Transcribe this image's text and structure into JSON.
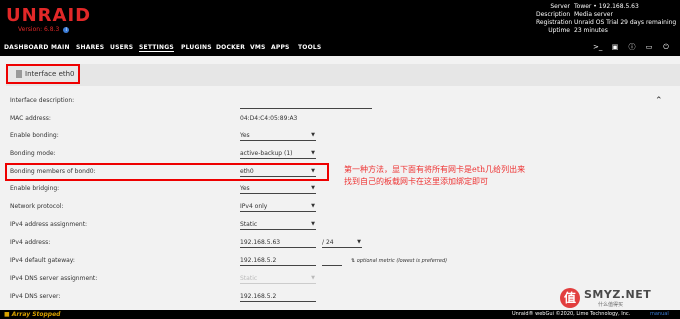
{
  "header": {
    "logo": "UNRAID",
    "version": "Version: 6.8.3",
    "server_info": [
      {
        "key": "Server",
        "value": "Tower • 192.168.5.63"
      },
      {
        "key": "Description",
        "value": "Media server"
      },
      {
        "key": "Registration",
        "value": "Unraid OS Trial 29 days remaining"
      },
      {
        "key": "Uptime",
        "value": "23 minutes"
      }
    ]
  },
  "nav": {
    "items": [
      "DASHBOARD",
      "MAIN",
      "SHARES",
      "USERS",
      "SETTINGS",
      "PLUGINS",
      "DOCKER",
      "VMS",
      "APPS",
      "TOOLS"
    ],
    "active": "SETTINGS",
    "icons": [
      "terminal-icon",
      "feedback-icon",
      "info-icon",
      "monitor-icon",
      "power-icon"
    ]
  },
  "panel": {
    "title": "Interface eth0"
  },
  "fields": {
    "interface_description": {
      "label": "Interface description:",
      "value": ""
    },
    "mac_address": {
      "label": "MAC address:",
      "value": "04:D4:C4:05:89:A3"
    },
    "enable_bonding": {
      "label": "Enable bonding:",
      "value": "Yes"
    },
    "bonding_mode": {
      "label": "Bonding mode:",
      "value": "active-backup (1)"
    },
    "bonding_members": {
      "label": "Bonding members of bond0:",
      "value": "eth0"
    },
    "enable_bridging": {
      "label": "Enable bridging:",
      "value": "Yes"
    },
    "network_protocol": {
      "label": "Network protocol:",
      "value": "IPv4 only"
    },
    "ipv4_assignment": {
      "label": "IPv4 address assignment:",
      "value": "Static"
    },
    "ipv4_address": {
      "label": "IPv4 address:",
      "value": "192.168.5.63",
      "prefix": "24"
    },
    "ipv4_gateway": {
      "label": "IPv4 default gateway:",
      "value": "192.168.5.2",
      "metric_note": "optional metric (lowest is preferred)"
    },
    "ipv4_dns_assignment": {
      "label": "IPv4 DNS server assignment:",
      "value": "Static"
    },
    "ipv4_dns_server": {
      "label": "IPv4 DNS server:",
      "value": "192.168.5.2"
    }
  },
  "annotation": {
    "line1": "第一种方法，显下面有将所有网卡是eth几给列出来",
    "line2": "找到自己的板载网卡在这里添加绑定即可"
  },
  "footer": {
    "array_status": "Array Stopped",
    "copyright": "Unraid® webGui ©2020, Lime Technology, Inc.",
    "manual": "manual"
  },
  "watermark": {
    "badge": "值",
    "title": "SMYZ.NET",
    "subtitle": "什么值得买"
  },
  "colors": {
    "brand": "#e22828",
    "highlight": "#ee0000",
    "annotation": "#e33333",
    "array_status": "#d9a100"
  }
}
